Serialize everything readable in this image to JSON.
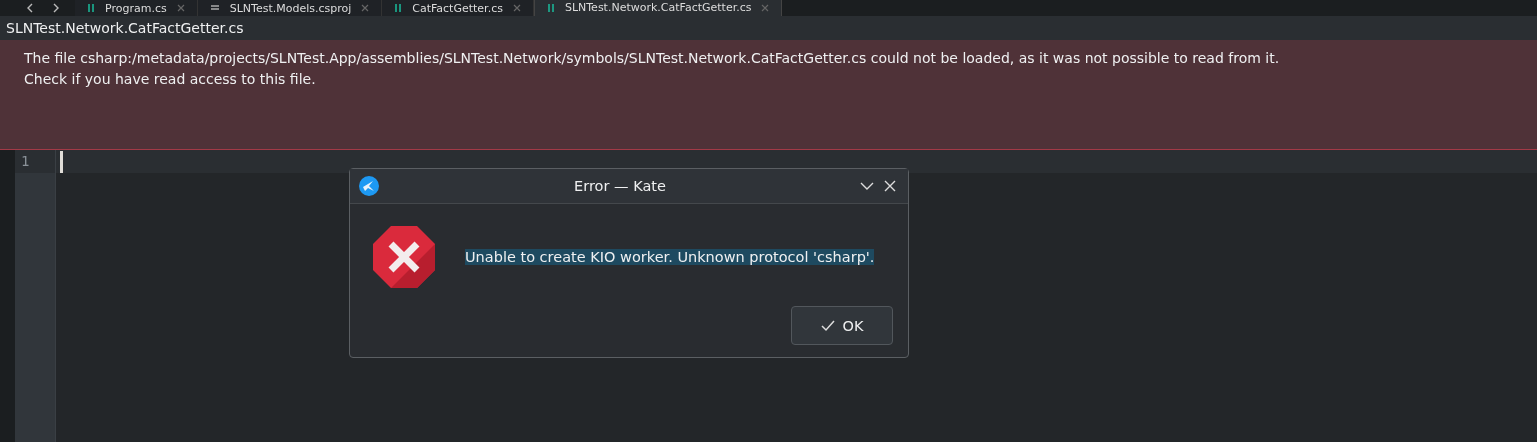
{
  "tabs": [
    {
      "label": "Program.cs",
      "kind": "code",
      "selected": false
    },
    {
      "label": "SLNTest.Models.csproj",
      "kind": "doc",
      "selected": false
    },
    {
      "label": "CatFactGetter.cs",
      "kind": "code",
      "selected": false
    },
    {
      "label": "SLNTest.Network.CatFactGetter.cs",
      "kind": "code",
      "selected": true
    }
  ],
  "file_title": "SLNTest.Network.CatFactGetter.cs",
  "error_banner": [
    "The file csharp:/metadata/projects/SLNTest.App/assemblies/SLNTest.Network/symbols/SLNTest.Network.CatFactGetter.cs could not be loaded, as it was not possible to read from it.",
    "Check if you have read access to this file."
  ],
  "line_numbers": [
    "1"
  ],
  "dialog": {
    "title": "Error — Kate",
    "message": "Unable to create KIO worker. Unknown protocol 'csharp'.",
    "button": "OK"
  }
}
